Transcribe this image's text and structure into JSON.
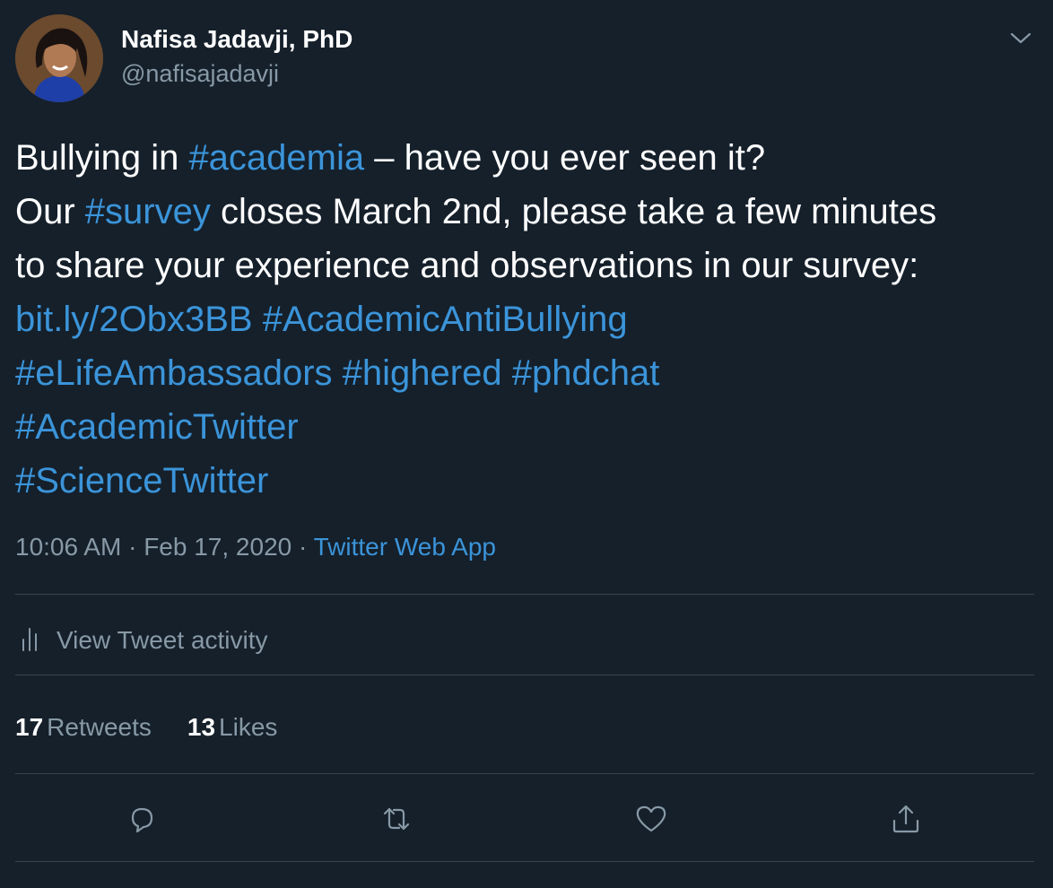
{
  "author": {
    "name": "Nafisa Jadavji, PhD",
    "handle": "@nafisajadavji"
  },
  "tweet": {
    "line1": {
      "pre": "Bullying in ",
      "tag": "#academia",
      "post": " – have you ever seen it?"
    },
    "line2": {
      "pre": "Our ",
      "tag": "#survey",
      "post": " closes March 2nd, please take a few minutes"
    },
    "line3": "to share your experience and observations in our survey:",
    "line4": {
      "link": "bit.ly/2Obx3BB",
      "tag": "#AcademicAntiBullying"
    },
    "line5": {
      "tag1": "#eLifeAmbassadors",
      "tag2": "#highered",
      "tag3": "#phdchat"
    },
    "line6": "#AcademicTwitter",
    "line7": "#ScienceTwitter"
  },
  "meta": {
    "time": "10:06 AM",
    "date": "Feb 17, 2020",
    "separator": "·",
    "app": "Twitter Web App"
  },
  "activity": {
    "label": "View Tweet activity",
    "icon": "bar-chart-icon"
  },
  "stats": {
    "retweets_count": "17",
    "retweets_label": "Retweets",
    "likes_count": "13",
    "likes_label": "Likes"
  },
  "actions": {
    "icons": [
      "reply-icon",
      "retweet-icon",
      "like-icon",
      "share-icon"
    ]
  },
  "colors": {
    "background": "#15202b",
    "link": "#3b94d9",
    "secondary_text": "#8899a6",
    "divider": "#38444d"
  }
}
